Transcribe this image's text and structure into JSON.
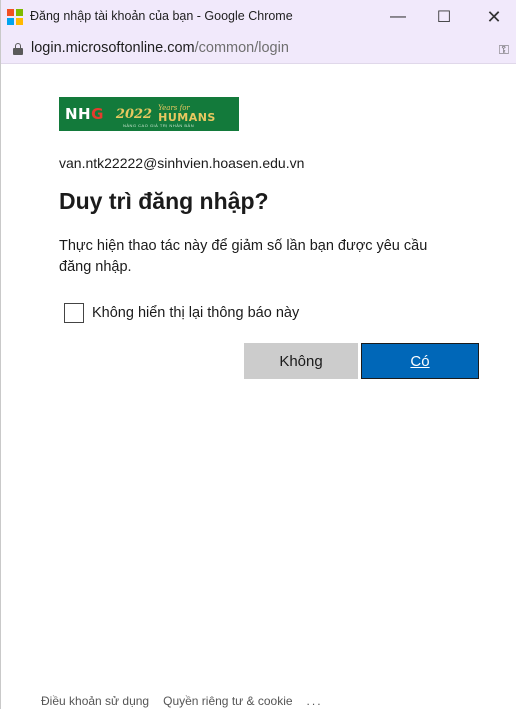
{
  "window": {
    "title": "Đăng nhập tài khoản của bạn - Google Chrome",
    "min_glyph": "—",
    "max_glyph": "☐",
    "close_glyph": "✕",
    "logo_colors": [
      "#f25022",
      "#7fba00",
      "#00a4ef",
      "#ffb900"
    ]
  },
  "address": {
    "host": "login.microsoftonline.com",
    "path": "/common/login",
    "key_glyph": "⚿"
  },
  "brand": {
    "nhg_main": "NH",
    "nhg_e": "G",
    "year": "2022",
    "years_for": "Years for",
    "humans": "HUMANS",
    "tagline": "NÂNG CAO GIÁ TRỊ NHÂN BẢN",
    "bg_color": "#137a3b"
  },
  "main": {
    "email": "van.ntk22222@sinhvien.hoasen.edu.vn",
    "heading": "Duy trì đăng nhập?",
    "description": "Thực hiện thao tác này để giảm số lần bạn được yêu cầu đăng nhập.",
    "checkbox_label": "Không hiển thị lại thông báo này",
    "checkbox_checked": false,
    "no_button": "Không",
    "yes_button": "Có",
    "accent_color": "#0067b8"
  },
  "footer": {
    "terms": "Điều khoản sử dụng",
    "privacy": "Quyền riêng tư & cookie",
    "more": "..."
  }
}
